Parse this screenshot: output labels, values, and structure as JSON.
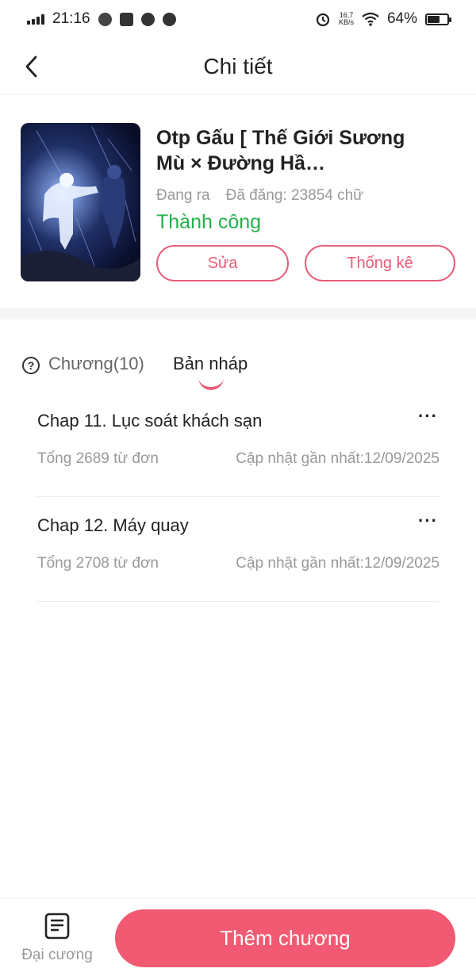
{
  "status_bar": {
    "time": "21:16",
    "speed_value": "16,7",
    "speed_unit": "KB/s",
    "battery": "64%",
    "battery_level": 0.64
  },
  "header": {
    "title": "Chi tiết"
  },
  "book": {
    "title": "Otp Gấu [ Thế Giới Sương Mù × Đường Hầ…",
    "state": "Đang ra",
    "posted": "Đã đăng: 23854 chữ",
    "status": "Thành công",
    "status_color": "#21b24a",
    "edit_label": "Sửa",
    "stats_label": "Thống kê"
  },
  "tabs": [
    {
      "label": "Chương(10)",
      "active": false
    },
    {
      "label": "Bản nháp",
      "active": true
    }
  ],
  "drafts": [
    {
      "title": "Chap 11. Lục soát khách sạn",
      "words": "Tổng 2689 từ đơn",
      "updated": "Cập nhật gần nhất:12/09/2025"
    },
    {
      "title": "Chap 12. Máy quay",
      "words": "Tổng 2708 từ đơn",
      "updated": "Cập nhật gần nhất:12/09/2025"
    }
  ],
  "more_icon": "···",
  "bottom": {
    "outline_label": "Đại cương",
    "add_chapter_label": "Thêm chương",
    "accent_color": "#f15a72"
  }
}
